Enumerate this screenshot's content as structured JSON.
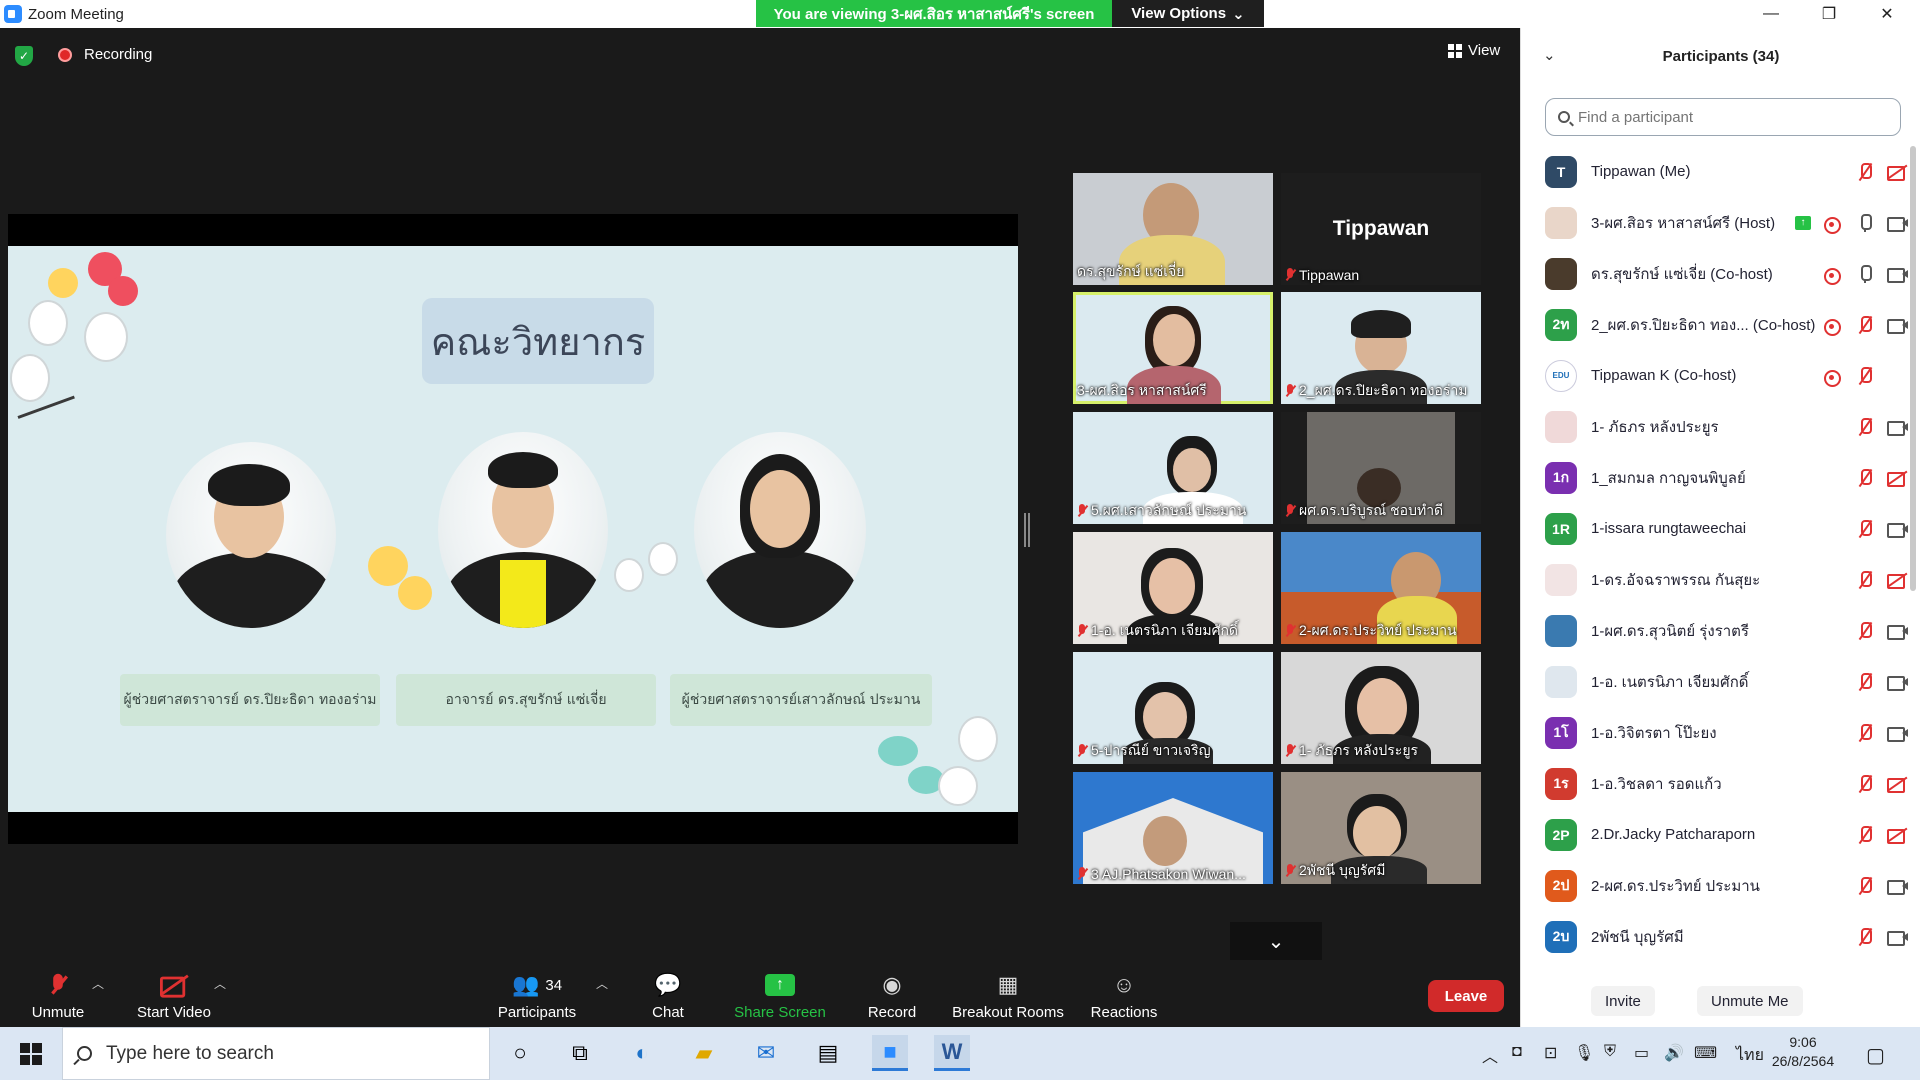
{
  "window": {
    "title": "Zoom Meeting",
    "minimize": "—",
    "restore": "❐",
    "close": "✕"
  },
  "share_banner": {
    "text": "You are viewing 3-ผศ.สิอร หาสาสน์ศรี's screen",
    "view_options": "View Options"
  },
  "meeting": {
    "recording_label": "Recording",
    "view_label": "View"
  },
  "slide": {
    "title": "คณะวิทยากร",
    "speakers": [
      "ผู้ช่วยศาสตราจารย์ ดร.ปิยะธิดา ทองอร่าม",
      "อาจารย์ ดร.สุขรักษ์ แซ่เจี่ย",
      "ผู้ช่วยศาสตราจารย์เสาวลักษณ์ ประมาน"
    ]
  },
  "tiles": [
    {
      "name": "ดร.สุขรักษ์ แซ่เจี่ย",
      "muted": false
    },
    {
      "name": "Tippawan",
      "big": "Tippawan",
      "muted": true
    },
    {
      "name": "3-ผศ.สิอร หาสาสน์ศรี",
      "muted": false
    },
    {
      "name": "2_ผศ.ดร.ปิยะธิดา ทองอร่าม",
      "muted": true
    },
    {
      "name": "5.ผศ.เสาวลักษณ์ ประมาน",
      "muted": true
    },
    {
      "name": "ผศ.ดร.บริบูรณ์ ชอบทำดี",
      "muted": true
    },
    {
      "name": "1-อ. เนตรนิภา เจียมศักดิ์",
      "muted": true
    },
    {
      "name": "2-ผศ.ดร.ประวิทย์ ประมาน",
      "muted": true
    },
    {
      "name": "5-ปารณีย์ ขาวเจริญ",
      "muted": true
    },
    {
      "name": "1- ภัธภร หลังประยูร",
      "muted": true
    },
    {
      "name": "3 AJ.Phatsakon Wiwan...",
      "muted": true
    },
    {
      "name": "2พัชนี บุญรัศมี",
      "muted": true
    }
  ],
  "toolbar": {
    "unmute": "Unmute",
    "start_video": "Start Video",
    "participants": "Participants",
    "participants_count": "34",
    "chat": "Chat",
    "share_screen": "Share Screen",
    "record": "Record",
    "breakout_rooms": "Breakout Rooms",
    "reactions": "Reactions",
    "leave": "Leave"
  },
  "panel": {
    "title": "Participants (34)",
    "search_placeholder": "Find a participant",
    "invite": "Invite",
    "unmute_me": "Unmute Me",
    "participants": [
      {
        "initials": "T",
        "color": "#2f4a66",
        "name": "Tippawan (Me)",
        "rec": false,
        "mic": "off",
        "cam": "off",
        "share": false
      },
      {
        "initials": "",
        "color": "#e9d6c9",
        "name": "3-ผศ.สิอร หาสาสน์ศรี (Host)",
        "rec": true,
        "mic": "on",
        "cam": "on",
        "share": true
      },
      {
        "initials": "",
        "color": "#4a3b2c",
        "name": "ดร.สุขรักษ์ แซ่เจี่ย (Co-host)",
        "rec": true,
        "mic": "on",
        "cam": "on",
        "share": false
      },
      {
        "initials": "2ท",
        "color": "#2da04a",
        "name": "2_ผศ.ดร.ปิยะธิดา ทอง... (Co-host)",
        "rec": true,
        "mic": "off",
        "cam": "on",
        "share": false
      },
      {
        "initials": "EDU",
        "color": "#ffffff",
        "name": "Tippawan K (Co-host)",
        "rec": true,
        "mic": "off",
        "cam": "none",
        "share": false
      },
      {
        "initials": "",
        "color": "#f0d9d9",
        "name": "1- ภัธภร หลังประยูร",
        "rec": false,
        "mic": "off",
        "cam": "on",
        "share": false
      },
      {
        "initials": "1ก",
        "color": "#7a2fb0",
        "name": "1_สมกมล กาญจนพิบูลย์",
        "rec": false,
        "mic": "off",
        "cam": "off",
        "share": false
      },
      {
        "initials": "1R",
        "color": "#2da04a",
        "name": "1-issara rungtaweechai",
        "rec": false,
        "mic": "off",
        "cam": "on",
        "share": false
      },
      {
        "initials": "",
        "color": "#f2e4e4",
        "name": "1-ดร.อัจฉราพรรณ กันสุยะ",
        "rec": false,
        "mic": "off",
        "cam": "off",
        "share": false
      },
      {
        "initials": "",
        "color": "#3a7ab0",
        "name": "1-ผศ.ดร.สุวนิตย์ รุ่งราตรี",
        "rec": false,
        "mic": "off",
        "cam": "on",
        "share": false
      },
      {
        "initials": "",
        "color": "#dfe7ee",
        "name": "1-อ. เนตรนิภา เจียมศักดิ์",
        "rec": false,
        "mic": "off",
        "cam": "on",
        "share": false
      },
      {
        "initials": "1โ",
        "color": "#7a2fb0",
        "name": "1-อ.วิจิตรตา โป๊ะยง",
        "rec": false,
        "mic": "off",
        "cam": "on",
        "share": false
      },
      {
        "initials": "1ร",
        "color": "#d13b2f",
        "name": "1-อ.วิชลดา รอดแก้ว",
        "rec": false,
        "mic": "off",
        "cam": "off",
        "share": false
      },
      {
        "initials": "2P",
        "color": "#2da04a",
        "name": "2.Dr.Jacky Patcharaporn",
        "rec": false,
        "mic": "off",
        "cam": "off",
        "share": false
      },
      {
        "initials": "2ป",
        "color": "#e05a1c",
        "name": "2-ผศ.ดร.ประวิทย์ ประมาน",
        "rec": false,
        "mic": "off",
        "cam": "on",
        "share": false
      },
      {
        "initials": "2บ",
        "color": "#1f6fb8",
        "name": "2พัชนี บุญรัศมี",
        "rec": false,
        "mic": "off",
        "cam": "on",
        "share": false
      }
    ]
  },
  "taskbar": {
    "search_placeholder": "Type here to search",
    "language": "ไทย",
    "time": "9:06",
    "date": "26/8/2564"
  }
}
